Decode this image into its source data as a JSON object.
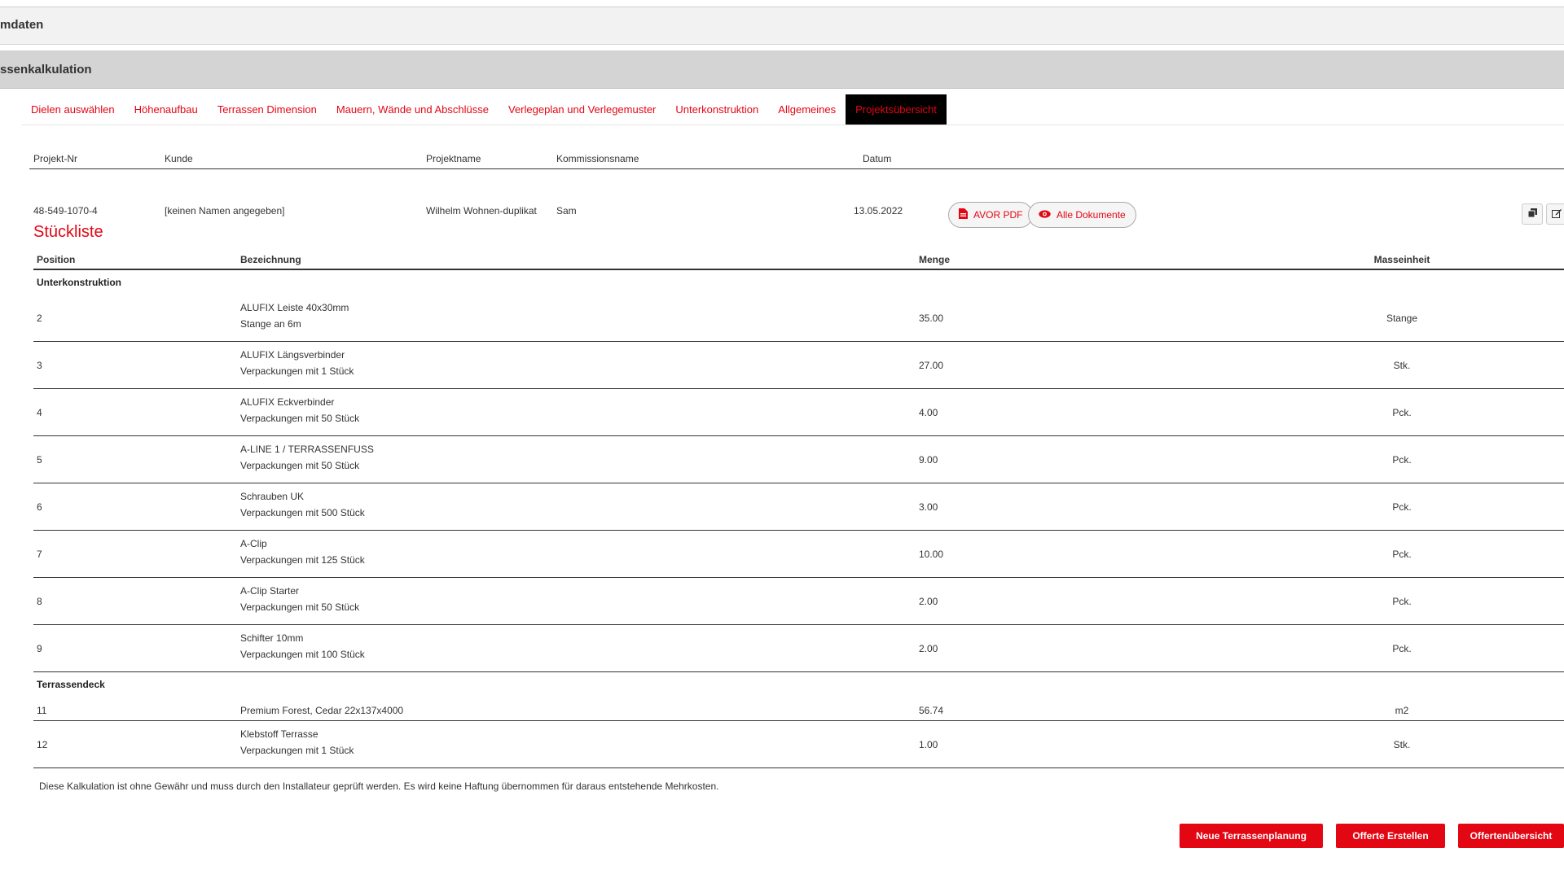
{
  "panels": {
    "stammdaten": "mdaten",
    "kalkulation": "ssenkalkulation"
  },
  "tabs": [
    {
      "label": "Dielen auswählen"
    },
    {
      "label": "Höhenaufbau"
    },
    {
      "label": "Terrassen Dimension"
    },
    {
      "label": "Mauern, Wände und Abschlüsse"
    },
    {
      "label": "Verlegeplan und Verlegemuster"
    },
    {
      "label": "Unterkonstruktion"
    },
    {
      "label": "Allgemeines"
    },
    {
      "label": "Projektsübersicht",
      "active": true
    }
  ],
  "project": {
    "headers": {
      "nr": "Projekt-Nr",
      "kunde": "Kunde",
      "projektname": "Projektname",
      "kommission": "Kommissionsname",
      "datum": "Datum"
    },
    "row": {
      "nr": "48-549-1070-4",
      "kunde": "[keinen Namen angegeben]",
      "projektname": "Wilhelm Wohnen-duplikat",
      "kommission": "Sam",
      "datum": "13.05.2022"
    },
    "avor_pdf": "AVOR PDF",
    "alle_dokumente": "Alle Dokumente"
  },
  "stueckliste": {
    "title": "Stückliste",
    "headers": {
      "position": "Position",
      "bezeichnung": "Bezeichnung",
      "menge": "Menge",
      "masseinheit": "Masseinheit"
    },
    "groups": [
      {
        "name": "Unterkonstruktion",
        "items": [
          {
            "pos": "2",
            "name": "ALUFIX Leiste 40x30mm",
            "sub": "Stange an 6m",
            "menge": "35.00",
            "unit": "Stange"
          },
          {
            "pos": "3",
            "name": "ALUFIX Längsverbinder",
            "sub": "Verpackungen mit 1 Stück",
            "menge": "27.00",
            "unit": "Stk."
          },
          {
            "pos": "4",
            "name": "ALUFIX Eckverbinder",
            "sub": "Verpackungen mit 50 Stück",
            "menge": "4.00",
            "unit": "Pck."
          },
          {
            "pos": "5",
            "name": "A-LINE 1 / TERRASSENFUSS",
            "sub": "Verpackungen mit 50 Stück",
            "menge": "9.00",
            "unit": "Pck."
          },
          {
            "pos": "6",
            "name": "Schrauben UK",
            "sub": "Verpackungen mit 500 Stück",
            "menge": "3.00",
            "unit": "Pck."
          },
          {
            "pos": "7",
            "name": "A-Clip",
            "sub": "Verpackungen mit 125 Stück",
            "menge": "10.00",
            "unit": "Pck."
          },
          {
            "pos": "8",
            "name": "A-Clip Starter",
            "sub": "Verpackungen mit 50 Stück",
            "menge": "2.00",
            "unit": "Pck."
          },
          {
            "pos": "9",
            "name": "Schifter 10mm",
            "sub": "Verpackungen mit 100 Stück",
            "menge": "2.00",
            "unit": "Pck."
          }
        ]
      },
      {
        "name": "Terrassendeck",
        "items": [
          {
            "pos": "11",
            "name": "Premium Forest, Cedar 22x137x4000",
            "sub": "",
            "menge": "56.74",
            "unit": "m2"
          },
          {
            "pos": "12",
            "name": "Klebstoff Terrasse",
            "sub": "Verpackungen mit 1 Stück",
            "menge": "1.00",
            "unit": "Stk."
          }
        ]
      }
    ]
  },
  "disclaimer": "Diese Kalkulation ist ohne Gewähr und muss durch den Installateur geprüft werden. Es wird keine Haftung übernommen für daraus entstehende Mehrkosten.",
  "buttons": {
    "neue": "Neue Terrassenplanung",
    "offerte": "Offerte Erstellen",
    "uebersicht": "Offertenübersicht"
  },
  "colors": {
    "accent": "#e30613",
    "active_tab_bg": "#000000"
  }
}
